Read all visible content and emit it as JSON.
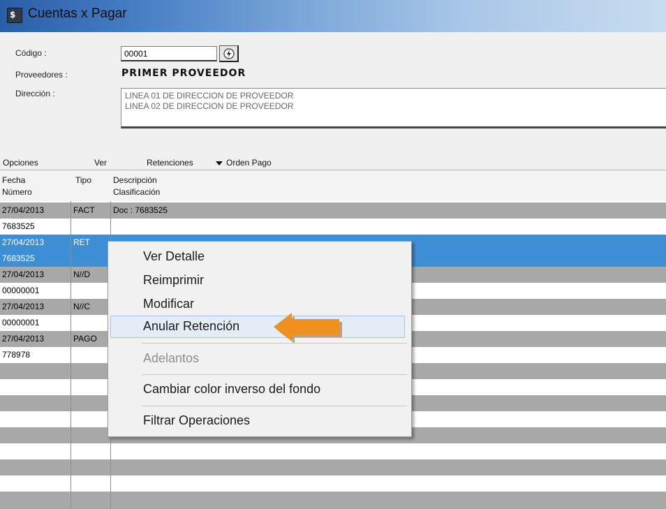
{
  "window": {
    "title": "Cuentas x Pagar"
  },
  "header": {
    "codigo_label": "Código :",
    "codigo_value": "00001",
    "proveedores_label": "Proveedores :",
    "proveedor_name": "PRIMER PROVEEDOR",
    "direccion_label": "Dirección :",
    "direccion_line1": "LINEA 01 DE DIRECCION DE PROVEEDOR",
    "direccion_line2": "LINEA 02 DE DIRECCION DE PROVEEDOR"
  },
  "menubar": {
    "opciones": "Opciones",
    "ver": "Ver",
    "retenciones": "Retenciones",
    "orden_pago": "Orden Pago"
  },
  "grid": {
    "columns": {
      "fecha": "Fecha",
      "numero": "Número",
      "tipo": "Tipo",
      "descripcion": "Descripción",
      "clasificacion": "Clasificación"
    },
    "rows": [
      {
        "fecha": "27/04/2013",
        "tipo": "FACT",
        "desc": "Doc : 7683525",
        "numero": "7683525"
      },
      {
        "fecha": "27/04/2013",
        "tipo": "RET",
        "desc": "",
        "numero": "7683525"
      },
      {
        "fecha": "27/04/2013",
        "tipo": "N//D",
        "desc": "",
        "numero": "00000001"
      },
      {
        "fecha": "27/04/2013",
        "tipo": "N//C",
        "desc": "",
        "numero": "00000001"
      },
      {
        "fecha": "27/04/2013",
        "tipo": "PAGO",
        "desc": "",
        "numero": "778978"
      }
    ]
  },
  "context_menu": {
    "ver_detalle": "Ver Detalle",
    "reimprimir": "Reimprimir",
    "modificar": "Modificar",
    "anular_retencion": "Anular Retención",
    "adelantos": "Adelantos",
    "cambiar_color": "Cambiar color inverso del fondo",
    "filtrar": "Filtrar Operaciones"
  },
  "colors": {
    "selection": "#3e8ed6",
    "stripe": "#a8a8a8",
    "arrow": "#f0901e"
  }
}
